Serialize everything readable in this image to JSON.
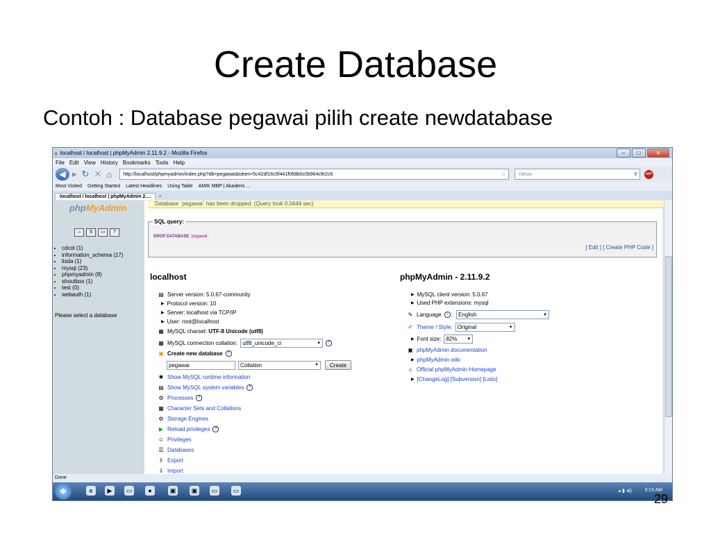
{
  "slide": {
    "title": "Create Database",
    "subtitle": "Contoh : Database pegawai pilih create newdatabase",
    "number": "29"
  },
  "browser": {
    "window_title": "localhost / localhost | phpMyAdmin 2.11.9.2 - Mozilla Firefox",
    "menu": [
      "File",
      "Edit",
      "View",
      "History",
      "Bookmarks",
      "Tools",
      "Help"
    ],
    "url": "http://localhost/phpmyadmin/index.php?db=pegawai&token=5c42df16c5f441f068b0c0b964cfe2c6",
    "search_placeholder": "Yahoo",
    "bookmarks": [
      "Most Visited",
      "Getting Started",
      "Latest Headlines",
      "Using Table",
      "AMIK MBP | Akademi ..."
    ],
    "tab_label": "localhost / localhost | phpMyAdmin 2....",
    "status": "Done",
    "clock": "3:13 AM"
  },
  "pma": {
    "logo_left": "php",
    "logo_right": "MyAdmin",
    "databases": [
      "cdcol (1)",
      "information_schema (17)",
      "lisda (1)",
      "mysql (23)",
      "phpmyadmin (8)",
      "shoutbox (1)",
      "test (0)",
      "webauth (1)"
    ],
    "select_prompt": "Please select a database",
    "message": "Database `pegawai` has been dropped. (Query took 0.0444 sec)",
    "sql_legend": "SQL query:",
    "sql_keyword": "DROP DATABASE",
    "sql_value": "`pegawai`",
    "sql_actions": "[ Edit ] [ Create PHP Code ]",
    "server_heading": "localhost",
    "server_version": "Server version: 5.0.67-community",
    "protocol": "Protocol version: 10",
    "server": "Server: localhost via TCP/IP",
    "user": "User: root@localhost",
    "charset_label": "MySQL charset:",
    "charset_value": "UTF-8 Unicode (utf8)",
    "collation_label": "MySQL connection collation:",
    "collation_value": "utf8_unicode_ci",
    "create_db_label": "Create new database",
    "new_db_name": "pegawai",
    "collation_placeholder": "Collation",
    "create_button": "Create",
    "links": [
      "Show MySQL runtime information",
      "Show MySQL system variables",
      "Processes",
      "Character Sets and Collations",
      "Storage Engines",
      "Reload privileges",
      "Privileges",
      "Databases",
      "Export",
      "Import"
    ],
    "app_heading": "phpMyAdmin - 2.11.9.2",
    "client_version": "MySQL client version: 5.0.67",
    "php_ext": "Used PHP extensions: mysql",
    "language_label": "Language",
    "language_value": "English",
    "theme_label": "Theme / Style:",
    "theme_value": "Original",
    "font_size_label": "Font size:",
    "font_size_value": "82%",
    "doc_link": "phpMyAdmin documentation",
    "wiki_link": "phpMyAdmin wiki",
    "homepage_link": "Official phpMyAdmin Homepage",
    "changelog_links": "[ChangeLog] [Subversion] [Lists]"
  }
}
